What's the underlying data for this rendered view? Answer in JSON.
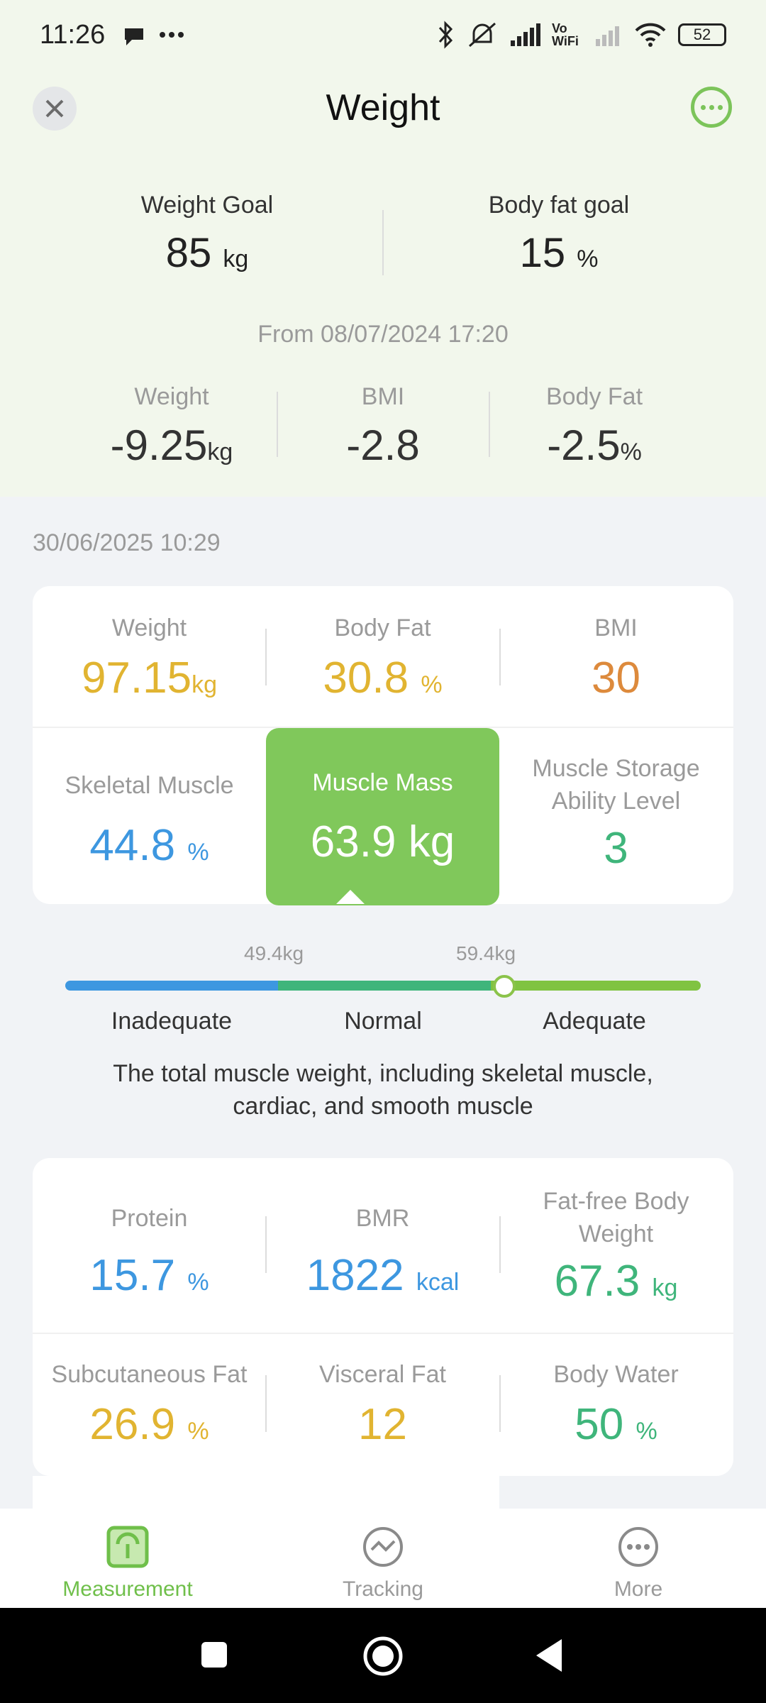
{
  "status_bar": {
    "time": "11:26",
    "battery": "52",
    "carrier_label": "Vo WiFi"
  },
  "header": {
    "title": "Weight"
  },
  "goals": {
    "weight": {
      "label": "Weight Goal",
      "value": "85",
      "unit": "kg"
    },
    "body_fat": {
      "label": "Body fat goal",
      "value": "15",
      "unit": "%"
    }
  },
  "from_text": "From 08/07/2024 17:20",
  "changes": [
    {
      "label": "Weight",
      "value": "-9.25",
      "unit": "kg"
    },
    {
      "label": "BMI",
      "value": "-2.8",
      "unit": ""
    },
    {
      "label": "Body Fat",
      "value": "-2.5",
      "unit": "%"
    }
  ],
  "measurement_date": "30/06/2025 10:29",
  "summary": {
    "weight": {
      "label": "Weight",
      "value": "97.15",
      "unit": "kg"
    },
    "body_fat": {
      "label": "Body Fat",
      "value": "30.8",
      "unit": "%"
    },
    "bmi": {
      "label": "BMI",
      "value": "30"
    },
    "skeletal_muscle": {
      "label": "Skeletal Muscle",
      "value": "44.8",
      "unit": "%"
    },
    "muscle_mass": {
      "label": "Muscle Mass",
      "value": "63.9",
      "unit": "kg"
    },
    "muscle_storage": {
      "label_line1": "Muscle Storage",
      "label_line2": "Ability Level",
      "value": "3"
    }
  },
  "muscle_scale": {
    "threshold_low": "49.4kg",
    "threshold_high": "59.4kg",
    "ranges": [
      "Inadequate",
      "Normal",
      "Adequate"
    ],
    "description_line1": "The total muscle weight, including skeletal muscle,",
    "description_line2": "cardiac, and smooth muscle"
  },
  "details": {
    "protein": {
      "label": "Protein",
      "value": "15.7",
      "unit": "%"
    },
    "bmr": {
      "label": "BMR",
      "value": "1822",
      "unit": "kcal"
    },
    "fat_free": {
      "label_line1": "Fat-free Body",
      "label_line2": "Weight",
      "value": "67.3",
      "unit": "kg"
    },
    "subcutaneous_fat": {
      "label": "Subcutaneous Fat",
      "value": "26.9",
      "unit": "%"
    },
    "visceral_fat": {
      "label": "Visceral Fat",
      "value": "12"
    },
    "body_water": {
      "label": "Body Water",
      "value": "50",
      "unit": "%"
    }
  },
  "bottom_nav": [
    {
      "label": "Measurement",
      "icon": "scale-icon",
      "active": true
    },
    {
      "label": "Tracking",
      "icon": "tracking-icon",
      "active": false
    },
    {
      "label": "More",
      "icon": "more-icon",
      "active": false
    }
  ],
  "colors": {
    "accent_green": "#80c85b",
    "yellow": "#e1b431",
    "orange": "#dd8a3c",
    "blue": "#3d97e0",
    "green": "#3fb57b"
  }
}
